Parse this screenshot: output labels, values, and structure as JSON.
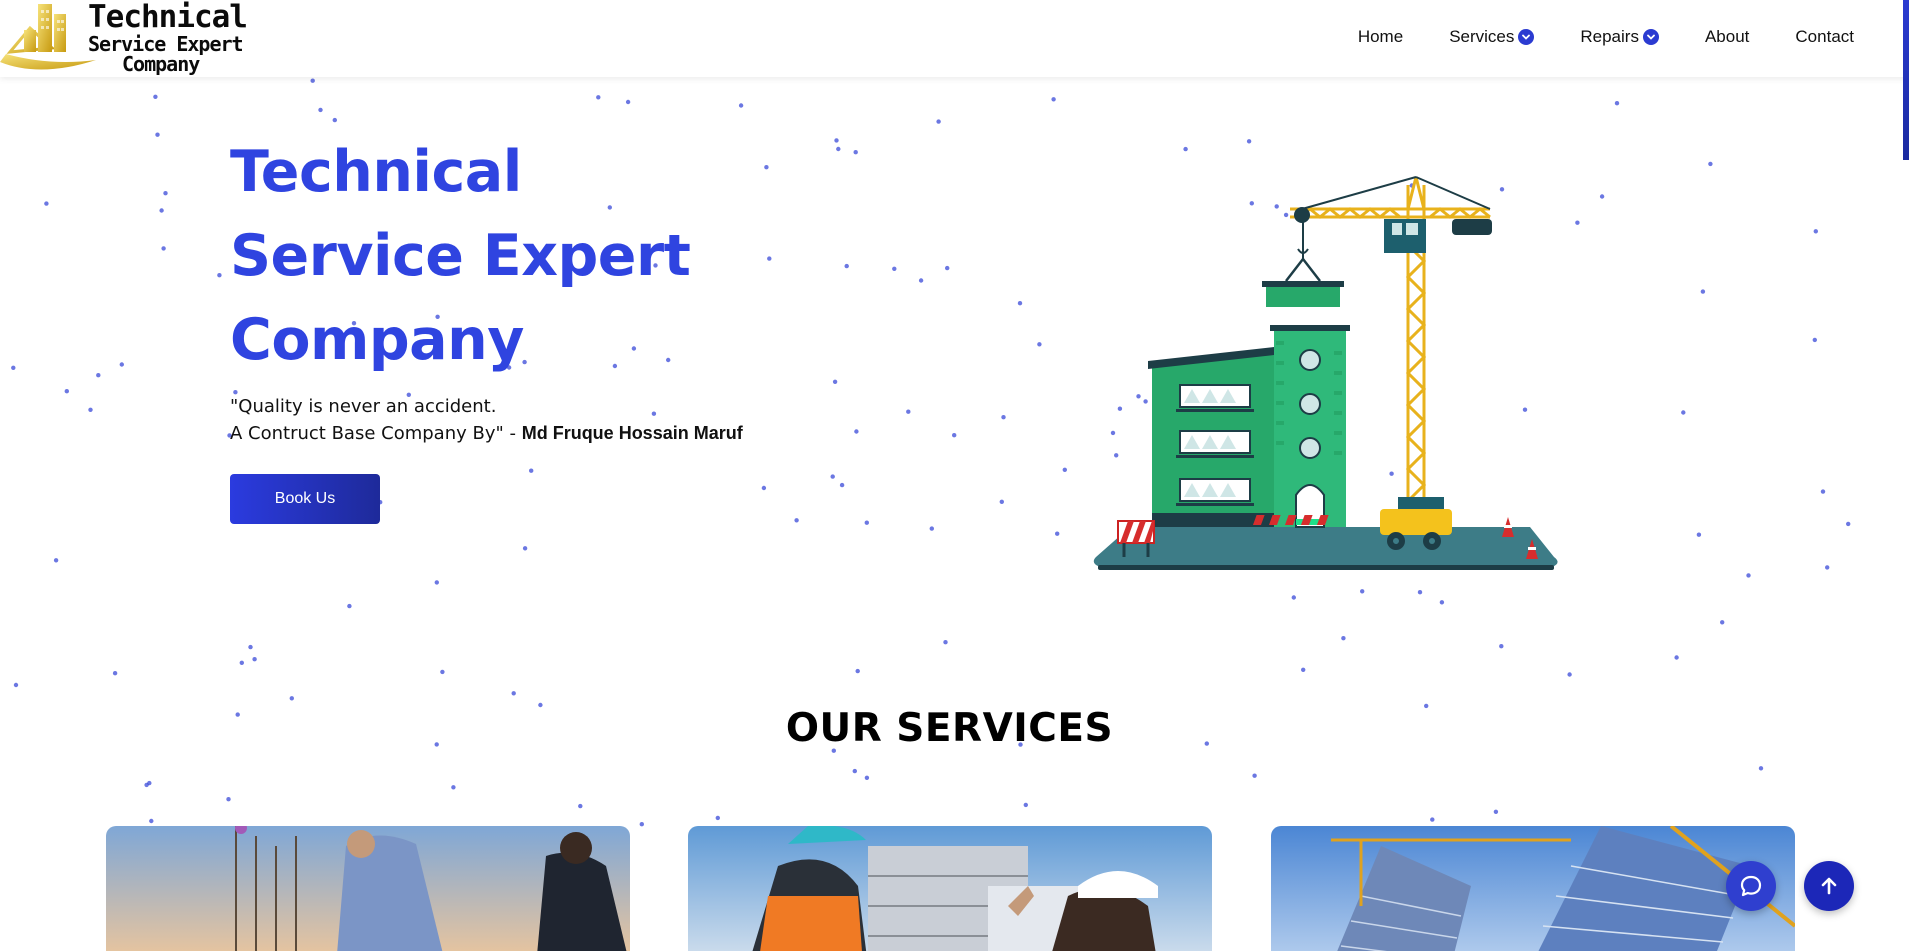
{
  "brand": {
    "line1": "Technical",
    "line2": "Service Expert",
    "line3": "Company"
  },
  "nav": {
    "items": [
      {
        "label": "Home",
        "has_dropdown": false
      },
      {
        "label": "Services",
        "has_dropdown": true
      },
      {
        "label": "Repairs",
        "has_dropdown": true
      },
      {
        "label": "About",
        "has_dropdown": false
      },
      {
        "label": "Contact",
        "has_dropdown": false
      }
    ]
  },
  "hero": {
    "title_line1": "Technical",
    "title_line2": "Service Expert",
    "title_line3": "Company",
    "quote_line1": "\"Quality is never an accident.",
    "quote_line2": "A Contruct Base Company By\" - ",
    "quote_author": "Md Fruque Hossain Maruf",
    "cta_label": "Book Us"
  },
  "services": {
    "heading": "OUR SERVICES",
    "cards": [
      {
        "image": "engineers-at-construction-site-photo"
      },
      {
        "image": "workers-in-hard-hats-photo"
      },
      {
        "image": "skyscraper-with-cranes-photo"
      }
    ]
  },
  "floating": {
    "chat_icon": "chat-bubble-icon",
    "top_icon": "arrow-up-icon"
  },
  "colors": {
    "accent": "#2f44e0",
    "button_start": "#2b3bdf",
    "button_end": "#1e2a9a",
    "particle": "#3a4ad8"
  }
}
